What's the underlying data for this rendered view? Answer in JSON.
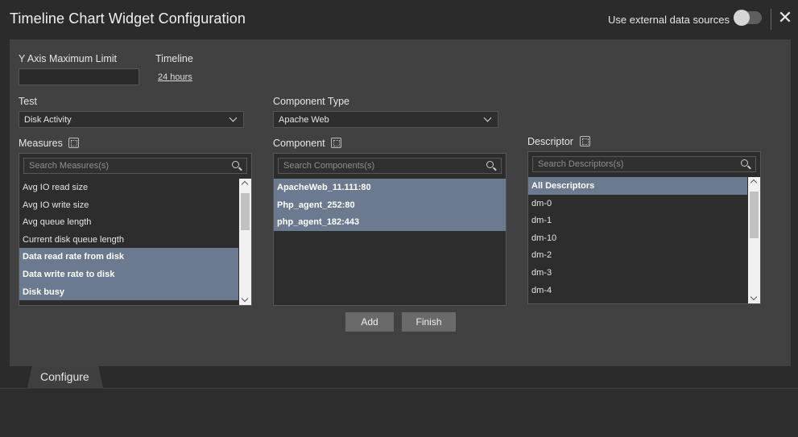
{
  "header": {
    "title": "Timeline Chart Widget Configuration",
    "external_label": "Use external data sources",
    "close_glyph": "✕"
  },
  "form": {
    "ymax_label": "Y Axis Maximum Limit",
    "ymax_value": "",
    "timeline_label": "Timeline",
    "timeline_value": "24 hours",
    "test_label": "Test",
    "test_value": "Disk Activity",
    "component_type_label": "Component Type",
    "component_type_value": "Apache Web"
  },
  "measures": {
    "label": "Measures",
    "placeholder": "Search Measures(s)",
    "items": [
      {
        "text": "Avg IO read size",
        "selected": false
      },
      {
        "text": "Avg IO write size",
        "selected": false
      },
      {
        "text": "Avg queue length",
        "selected": false
      },
      {
        "text": "Current disk queue length",
        "selected": false
      },
      {
        "text": "Data read rate from disk",
        "selected": true
      },
      {
        "text": "Data write rate to disk",
        "selected": true
      },
      {
        "text": "Disk busy",
        "selected": true
      }
    ]
  },
  "components": {
    "label": "Component",
    "placeholder": "Search Components(s)",
    "items": [
      {
        "text": "ApacheWeb_11.111:80",
        "selected": true
      },
      {
        "text": "Php_agent_252:80",
        "selected": true
      },
      {
        "text": "php_agent_182:443",
        "selected": true
      }
    ]
  },
  "descriptors": {
    "label": "Descriptor",
    "placeholder": "Search Descriptors(s)",
    "items": [
      {
        "text": "All Descriptors",
        "selected": true
      },
      {
        "text": "dm-0",
        "selected": false
      },
      {
        "text": "dm-1",
        "selected": false
      },
      {
        "text": "dm-10",
        "selected": false
      },
      {
        "text": "dm-2",
        "selected": false
      },
      {
        "text": "dm-3",
        "selected": false
      },
      {
        "text": "dm-4",
        "selected": false
      }
    ]
  },
  "buttons": {
    "add": "Add",
    "finish": "Finish"
  },
  "tabs": {
    "configure": "Configure"
  }
}
